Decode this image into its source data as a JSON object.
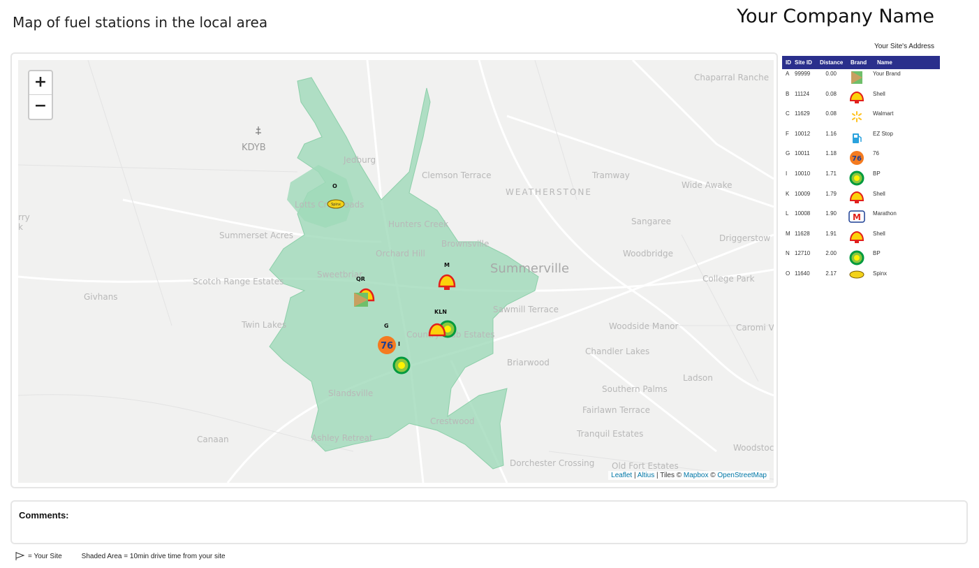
{
  "header": {
    "title": "Map of fuel stations in the local area",
    "company": "Your Company Name",
    "site_address": "Your Site's Address"
  },
  "map": {
    "zoom_in": "+",
    "zoom_out": "−",
    "attribution": {
      "leaflet": "Leaflet",
      "sep1": " | ",
      "altius": "Altius",
      "tiles": " | Tiles © ",
      "mapbox": "Mapbox",
      "copy": " © ",
      "osm": "OpenStreetMap"
    },
    "places": {
      "kdyb": "KDYB",
      "jedburg": "Jedburg",
      "clemson_terrace": "Clemson Terrace",
      "tramway": "Tramway",
      "wide_awake": "Wide Awake",
      "chaparral": "Chaparral Ranche",
      "weatherstone": "WEATHERSTONE",
      "lotts_crossroads": "Lotts Crossroads",
      "hunters_creek": "Hunters Creek",
      "sangaree": "Sangaree",
      "driggerstow": "Driggerstow",
      "summerset_acres": "Summerset Acres",
      "orchard_hill": "Orchard Hill",
      "brownsville": "Brownsville",
      "summerville": "Summerville",
      "woodbridge": "Woodbridge",
      "scotch_range": "Scotch Range Estates",
      "sweetbriar": "Sweetbriar",
      "college_park": "College Park",
      "givhans": "Givhans",
      "sawmill_terrace": "Sawmill Terrace",
      "twin_lakes": "Twin Lakes",
      "woodside_manor": "Woodside Manor",
      "carom": "Caromi V",
      "country_club": "Country Club Estates",
      "chandler_lakes": "Chandler Lakes",
      "briarwood": "Briarwood",
      "ladson": "Ladson",
      "slandsville": "Slandsville",
      "southern_palms": "Southern Palms",
      "fairlawn": "Fairlawn Terrace",
      "crestwood": "Crestwood",
      "canaan": "Canaan",
      "ashley_retreat": "Ashley Retreat",
      "tranquil": "Tranquil Estates",
      "woodstoc": "Woodstoc",
      "dorchester": "Dorchester Crossing",
      "old_fort": "Old Fort Estates",
      "left_edge": "rry",
      "left_edge2": "k"
    },
    "marker_labels": {
      "o": "O",
      "m": "M",
      "qr": "QR",
      "kln": "KLN",
      "g": "G",
      "i": "I"
    }
  },
  "table": {
    "headers": [
      "ID",
      "Site ID",
      "Distance",
      "Brand",
      "Name"
    ],
    "rows": [
      {
        "id": "A",
        "site_id": "99999",
        "distance": "0.00",
        "brand_icon": "your-brand-flag-icon",
        "name": "Your Brand"
      },
      {
        "id": "B",
        "site_id": "11124",
        "distance": "0.08",
        "brand_icon": "shell-icon",
        "name": "Shell"
      },
      {
        "id": "C",
        "site_id": "11629",
        "distance": "0.08",
        "brand_icon": "walmart-spark-icon",
        "name": "Walmart"
      },
      {
        "id": "F",
        "site_id": "10012",
        "distance": "1.16",
        "brand_icon": "fuel-pump-icon",
        "name": "EZ Stop"
      },
      {
        "id": "G",
        "site_id": "10011",
        "distance": "1.18",
        "brand_icon": "76-icon",
        "name": "76"
      },
      {
        "id": "I",
        "site_id": "10010",
        "distance": "1.71",
        "brand_icon": "bp-icon",
        "name": "BP"
      },
      {
        "id": "K",
        "site_id": "10009",
        "distance": "1.79",
        "brand_icon": "shell-icon",
        "name": "Shell"
      },
      {
        "id": "L",
        "site_id": "10008",
        "distance": "1.90",
        "brand_icon": "marathon-icon",
        "name": "Marathon"
      },
      {
        "id": "M",
        "site_id": "11628",
        "distance": "1.91",
        "brand_icon": "shell-icon",
        "name": "Shell"
      },
      {
        "id": "N",
        "site_id": "12710",
        "distance": "2.00",
        "brand_icon": "bp-icon",
        "name": "BP"
      },
      {
        "id": "O",
        "site_id": "11640",
        "distance": "2.17",
        "brand_icon": "spinx-icon",
        "name": "Spinx"
      }
    ]
  },
  "comments": {
    "label": "Comments:"
  },
  "legend": {
    "site": "= Your Site",
    "shaded": "Shaded Area = 10min drive time from your site"
  },
  "colors": {
    "isochrone": "#9fd9b9",
    "table_header": "#2a2f8c",
    "shell_yellow": "#fcd20b",
    "shell_red": "#e2201b",
    "bp_green": "#009a3e",
    "link": "#0078a8"
  }
}
